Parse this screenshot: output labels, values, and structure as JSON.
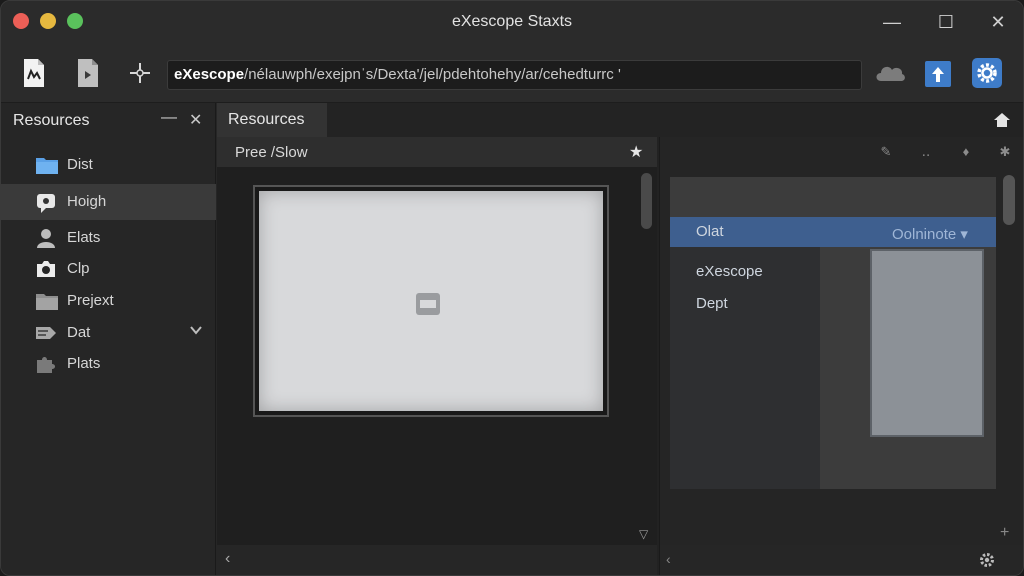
{
  "window": {
    "title": "eXescope Staxts",
    "controls": {
      "minimize": "—",
      "maximize": "☐",
      "close": "✕"
    }
  },
  "toolbar": {
    "path_bold": "eXescope",
    "path_rest": "/nélauwph/exejpnˈs/Dexta'/jel/pdehtohehy/ar/cehedturrc '",
    "icons": [
      "new-file-icon",
      "open-file-icon",
      "crosshair-icon",
      "cloud-icon",
      "upload-icon",
      "settings-icon"
    ]
  },
  "sidebar": {
    "title": "Resources",
    "items": [
      {
        "label": "Dist",
        "icon": "folder-icon"
      },
      {
        "label": "Hoigh",
        "icon": "speech-bubble-icon",
        "selected": true
      },
      {
        "label": "Elats",
        "icon": "user-icon"
      },
      {
        "label": "Clp",
        "icon": "camera-icon"
      },
      {
        "label": "Prejext",
        "icon": "folder-icon"
      },
      {
        "label": "Dat",
        "icon": "tag-icon",
        "expandable": true
      },
      {
        "label": "Plats",
        "icon": "puzzle-icon"
      }
    ]
  },
  "center": {
    "tab_label": "Resources",
    "subheader_label": "Pree /Slow"
  },
  "right_pane": {
    "shot_rows": [
      "Olat",
      "eXescope",
      "Dept"
    ],
    "shot_header_right": "Oolninote ▾"
  },
  "colors": {
    "accent": "#3e7cc9",
    "background": "#262626",
    "selected": "#3a3a3a"
  }
}
